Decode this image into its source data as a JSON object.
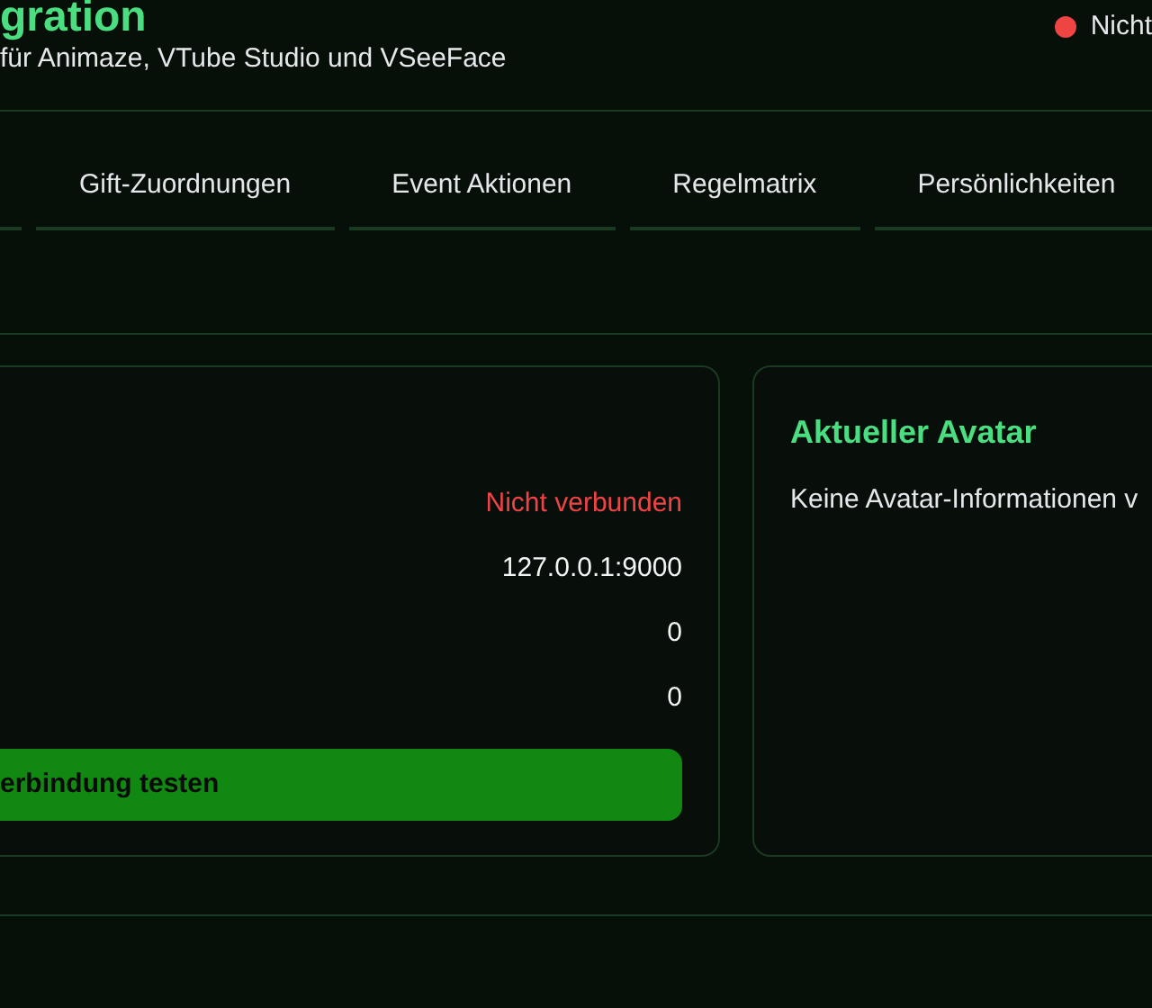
{
  "header": {
    "title": "gration",
    "subtitle": "für Animaze, VTube Studio und VSeeFace",
    "status": {
      "connected": false,
      "label": "Nicht"
    }
  },
  "tabs": [
    {
      "label": "Gift-Zuordnungen",
      "selected": false
    },
    {
      "label": "Event Aktionen",
      "selected": false
    },
    {
      "label": "Regelmatrix",
      "selected": false
    },
    {
      "label": "Persönlichkeiten",
      "selected": false
    }
  ],
  "connection_card": {
    "values": [
      {
        "text": "Nicht verbunden",
        "kind": "error"
      },
      {
        "text": "127.0.0.1:9000",
        "kind": "plain"
      },
      {
        "text": "0",
        "kind": "plain"
      },
      {
        "text": "0",
        "kind": "plain"
      }
    ],
    "button": "erbindung testen"
  },
  "avatar_card": {
    "title": "Aktueller Avatar",
    "text": "Keine Avatar-Informationen v"
  }
}
